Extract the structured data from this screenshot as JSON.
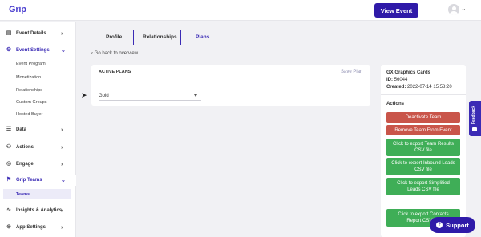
{
  "app": {
    "logo": "Grip"
  },
  "header": {
    "view_event_label": "View Event",
    "avatar_chevron": "⌄"
  },
  "sidebar": {
    "event_details": "Event Details",
    "event_settings": "Event Settings",
    "sub_items": [
      "Event Program",
      "Monetization",
      "Relationships",
      "Custom Groups",
      "Hosted Buyer"
    ],
    "data": "Data",
    "actions": "Actions",
    "engage": "Engage",
    "grip_teams": "Grip Teams",
    "teams": "Teams",
    "insights": "Insights & Analytics",
    "app_settings": "App Settings"
  },
  "tabs": [
    "Profile",
    "Relationships",
    "Plans"
  ],
  "back_link": "Go back to overview",
  "plans": {
    "title": "ACTIVE PLANS",
    "save_label": "Save Plan",
    "selected_plan": "Gold"
  },
  "team": {
    "name": "GX Graphics Cards",
    "id_label": "ID:",
    "id_value": "56044",
    "created_label": "Created:",
    "created_value": "2022-07-14 15:58:20",
    "actions_title": "Actions",
    "buttons": {
      "deactivate": "Deactivate Team",
      "remove": "Remove Team From Event",
      "export_results": "Click to export Team Results CSV file",
      "export_inbound": "Click to export Inbound Leads CSV file",
      "export_simplified": "Click to export Simplified Leads CSV file",
      "export_contacts": "Click to export Contacts Report CSV file"
    }
  },
  "feedback_label": "Feedback",
  "support_label": "Support",
  "colors": {
    "primary": "#2f1aa8",
    "accent": "#3b2bb5",
    "danger": "#c9554a",
    "success": "#3fae57"
  }
}
